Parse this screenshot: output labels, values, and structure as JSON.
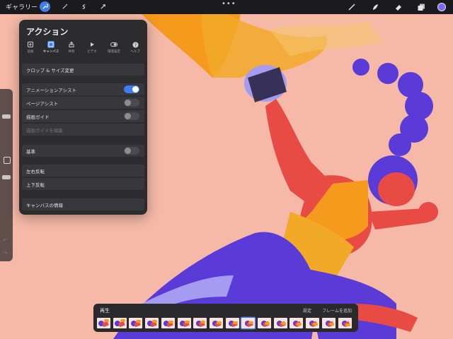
{
  "topbar": {
    "gallery_label": "ギャラリー",
    "menu_dots": "•••"
  },
  "panel": {
    "title": "アクション",
    "tabs": [
      {
        "label": "追加",
        "icon": "add-icon"
      },
      {
        "label": "キャンバス",
        "icon": "canvas-icon",
        "active": true
      },
      {
        "label": "共有",
        "icon": "share-icon"
      },
      {
        "label": "ビデオ",
        "icon": "video-icon"
      },
      {
        "label": "環境設定",
        "icon": "toggle-icon"
      },
      {
        "label": "ヘルプ",
        "icon": "help-icon"
      }
    ],
    "crop_label": "クロップ & サイズ変更",
    "animation_assist": {
      "label": "アニメーションアシスト",
      "on": true
    },
    "page_assist": {
      "label": "ページアシスト",
      "on": false
    },
    "drawing_guide": {
      "label": "描画ガイド",
      "on": false
    },
    "edit_guide_label": "描画ガイドを編集",
    "reference": {
      "label": "基準",
      "on": false
    },
    "flip_horizontal_label": "左右反転",
    "flip_vertical_label": "上下反転",
    "canvas_info_label": "キャンバスの情報"
  },
  "timeline": {
    "play_label": "再生",
    "settings_label": "設定",
    "add_frame_label": "フレームを追加",
    "frame_count": 16,
    "current_frame": 9
  },
  "colors": {
    "accent": "#3d7df0",
    "background": "#f6b9a8",
    "purple": "#5a3bd8",
    "orange": "#f59a1c",
    "red": "#e84a44",
    "current_color": "#7a68ff"
  }
}
